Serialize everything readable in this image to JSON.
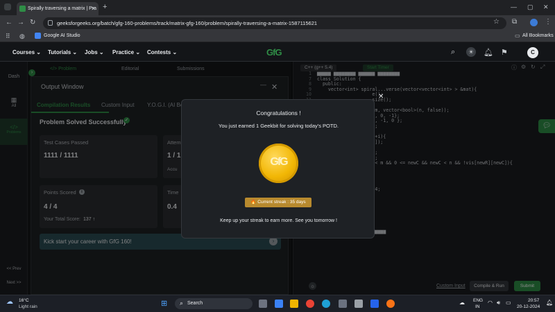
{
  "browser": {
    "tab_title": "Spirally traversing a matrix | Pra",
    "url": "geeksforgeeks.org/batch/gfg-160-problems/track/matrix-gfg-160/problem/spirally-traversing-a-matrix-1587115621",
    "bookmark_1": "Google AI Studio",
    "all_bookmarks": "All Bookmarks"
  },
  "nav": {
    "courses": "Courses ⌄",
    "tutorials": "Tutorials ⌄",
    "jobs": "Jobs ⌄",
    "practice": "Practice ⌄",
    "contests": "Contests ⌄",
    "logo": "GfG",
    "avatar": "C"
  },
  "sidebar": {
    "dash": "Dash",
    "all": "All",
    "problems": "Problems",
    "prev": "<< Prev",
    "next": "Next >>"
  },
  "problem_tabs": {
    "problem": "</> Problem",
    "editorial": "Editorial",
    "submissions": "Submissions"
  },
  "output": {
    "title": "Output Window",
    "tab_results": "Compilation Results",
    "tab_custom": "Custom Input",
    "tab_yogi": "Y.O.G.I. (AI Bot)",
    "status": "Problem Solved Successfully",
    "test_cases_label": "Test Cases Passed",
    "test_cases_value": "1111 / 1111",
    "attempts_label": "Attem",
    "attempts_value": "1 / 1",
    "accuracy_label": "Accu",
    "points_label": "Points Scored",
    "points_value": "4 / 4",
    "total_score_label": "Your Total Score:",
    "total_score_value": "137 ↑",
    "time_label": "Time",
    "time_value": "0.4",
    "banner": "Kick start your career with GfG 160!"
  },
  "editor": {
    "language": "C++ (g++ 5.4)",
    "start_timer": "Start Timer",
    "custom_input": "Custom Input",
    "compile_run": "Compile & Run",
    "submit": "Submit",
    "lines": [
      {
        "n": "1",
        "t": "▆▆▆▆▆ ▆▆▆▆▆▆▆▆ ▆▆▆▆▆▆ ▆▆▆▆▆▆▆▆"
      },
      {
        "n": "7",
        "t": "class Solution {"
      },
      {
        "n": "8",
        "t": "  public:"
      },
      {
        "n": "9",
        "t": "    vector<int> spiral...verse(vector<vector<int> > &mat){"
      },
      {
        "n": "10",
        "t": "                    e();"
      },
      {
        "n": "11",
        "t": "                    size();"
      },
      {
        "n": "12",
        "t": "                    ;"
      },
      {
        "n": "13",
        "t": "         bool> > vis(m, vector<bool>(n, false));"
      },
      {
        "n": "14",
        "t": "                    1, 0, -1};"
      },
      {
        "n": "15",
        "t": "                    0, -1, 0 };"
      },
      {
        "n": "16",
        "t": "                    0;"
      },
      {
        "n": "17",
        "t": ""
      },
      {
        "n": "18",
        "t": "         i < m * n; ++i){"
      },
      {
        "n": "19",
        "t": "         ack(mat[r][c]);"
      },
      {
        "n": "20",
        "t": "          = true;"
      },
      {
        "n": "21",
        "t": "          r + dr[idx];"
      },
      {
        "n": "22",
        "t": "          c + dc[idx];"
      },
      {
        "n": "23",
        "t": "         ewR && newR < m && 0 <= newC && newC < n && !vis[newR][newC]){"
      },
      {
        "n": "24",
        "t": "         wR;"
      },
      {
        "n": "25",
        "t": "         wC;"
      },
      {
        "n": "26",
        "t": ""
      },
      {
        "n": "27",
        "t": ""
      },
      {
        "n": "28",
        "t": "         (idx + 1) % 4;"
      },
      {
        "n": "29",
        "t": "         [idx];"
      },
      {
        "n": "30",
        "t": "         [idx];"
      },
      {
        "n": "31",
        "t": ""
      },
      {
        "n": "32",
        "t": ""
      },
      {
        "n": "33",
        "t": "    }"
      },
      {
        "n": "34",
        "t": "    }"
      },
      {
        "n": "35",
        "t": "};"
      },
      {
        "n": "36",
        "t": "▆▆▆▆▆▆▆▆ ▆▆▆▆ ▆▆▆▆▆ ▆▆▆▆▆"
      }
    ]
  },
  "modal": {
    "title": "Congratulations !",
    "message": "You just earned 1 Geekbit for solving today's POTD.",
    "coin_text": "GfG",
    "streak": "🔥 Current streak : 35 days",
    "footer": "Keep up your streak to earn more. See you tomorrow !"
  },
  "taskbar": {
    "temp": "16°C",
    "weather": "Light rain",
    "search": "Search",
    "lang1": "ENG",
    "lang2": "IN",
    "time": "20:57",
    "date": "20-12-2024"
  },
  "colors": {
    "gfg_green": "#2f8d46",
    "coin_gold": "#f2b705",
    "streak_bg": "#b88a2e",
    "submit_green": "#2f8d46"
  }
}
